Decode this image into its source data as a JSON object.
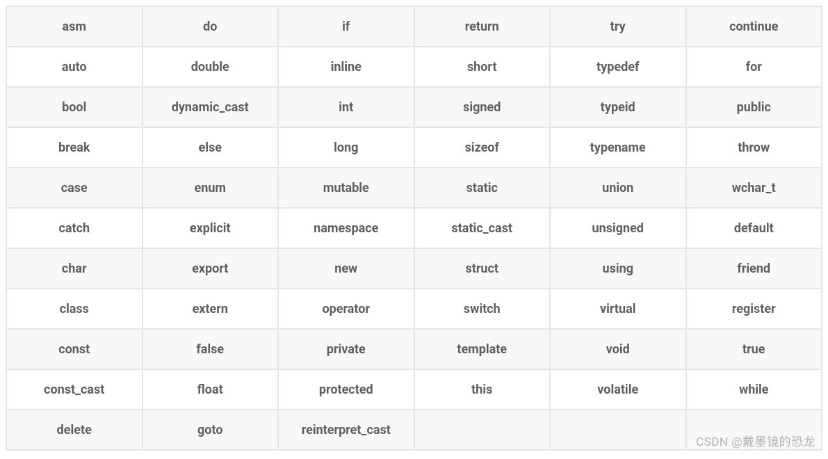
{
  "table": {
    "rows": [
      [
        "asm",
        "do",
        "if",
        "return",
        "try",
        "continue"
      ],
      [
        "auto",
        "double",
        "inline",
        "short",
        "typedef",
        "for"
      ],
      [
        "bool",
        "dynamic_cast",
        "int",
        "signed",
        "typeid",
        "public"
      ],
      [
        "break",
        "else",
        "long",
        "sizeof",
        "typename",
        "throw"
      ],
      [
        "case",
        "enum",
        "mutable",
        "static",
        "union",
        "wchar_t"
      ],
      [
        "catch",
        "explicit",
        "namespace",
        "static_cast",
        "unsigned",
        "default"
      ],
      [
        "char",
        "export",
        "new",
        "struct",
        "using",
        "friend"
      ],
      [
        "class",
        "extern",
        "operator",
        "switch",
        "virtual",
        "register"
      ],
      [
        "const",
        "false",
        "private",
        "template",
        "void",
        "true"
      ],
      [
        "const_cast",
        "float",
        "protected",
        "this",
        "volatile",
        "while"
      ],
      [
        "delete",
        "goto",
        "reinterpret_cast",
        "",
        "",
        ""
      ]
    ]
  },
  "watermark": "CSDN @戴墨镜的恐龙"
}
